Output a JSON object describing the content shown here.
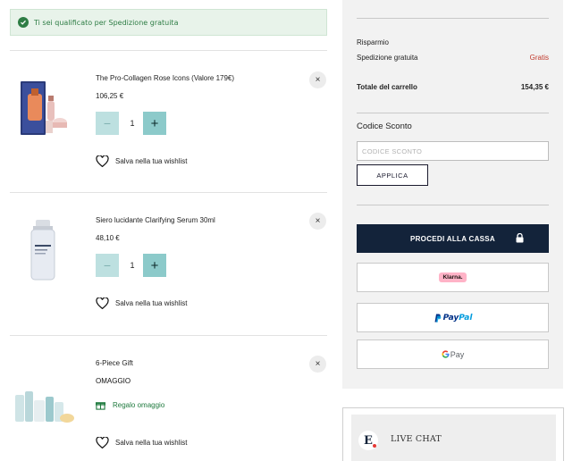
{
  "notice": {
    "text": "Ti sei qualificato per Spedizione gratuita"
  },
  "cart": {
    "items": [
      {
        "name": "The Pro-Collagen Rose Icons (Valore 179€)",
        "price": "106,25 €",
        "quantity": "1",
        "wishlist_label": "Salva nella tua wishlist",
        "remove_icon": "×"
      },
      {
        "name": "Siero lucidante Clarifying Serum 30ml",
        "price": "48,10 €",
        "quantity": "1",
        "wishlist_label": "Salva nella tua wishlist",
        "remove_icon": "×"
      },
      {
        "name": "6-Piece Gift",
        "price": "OMAGGIO",
        "gift_label": "Regalo omaggio",
        "wishlist_label": "Salva nella tua wishlist",
        "remove_icon": "×"
      }
    ],
    "qty_minus": "−",
    "qty_plus": "+"
  },
  "summary": {
    "savings_label": "Risparmio",
    "shipping_label": "Spedizione gratuita",
    "shipping_value": "Gratis",
    "total_label": "Totale del carrello",
    "total_value": "154,35 €",
    "coupon_title": "Codice Sconto",
    "coupon_placeholder": "CODICE SCONTO",
    "apply_label": "APPLICA",
    "checkout_label": "PROCEDI ALLA CASSA",
    "klarna_label": "Klarna.",
    "paypal_label_1": "Pay",
    "paypal_label_2": "Pal",
    "gpay_label": "Pay"
  },
  "chat": {
    "label": "LIVE CHAT",
    "logo": "E"
  },
  "colors": {
    "accent_green": "#2e7d45",
    "qty_button": "#8ccaca",
    "checkout_bg": "#13233a",
    "free_red": "#c0392b"
  }
}
